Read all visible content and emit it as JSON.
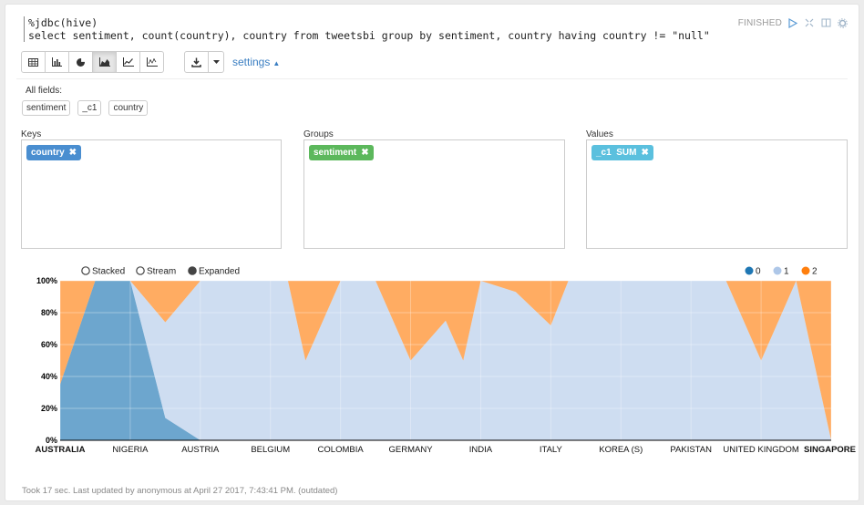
{
  "paragraph": {
    "code_lines": [
      "%jdbc(hive)",
      "select sentiment, count(country), country from tweetsbi group by sentiment, country having country != \"null\""
    ],
    "status": "FINISHED",
    "footer": "Took 17 sec. Last updated by anonymous at April 27 2017, 7:43:41 PM. (outdated)"
  },
  "toolbar": {
    "buttons": [
      "table-icon",
      "bar-chart-icon",
      "pie-chart-icon",
      "area-chart-icon",
      "line-chart-icon",
      "scatter-chart-icon"
    ],
    "active": "area-chart-icon",
    "settings_label": "settings"
  },
  "fields": {
    "label": "All fields:",
    "items": [
      "sentiment",
      "_c1",
      "country"
    ]
  },
  "keys": {
    "label": "Keys",
    "pill": "country",
    "color": "#4a8ed0"
  },
  "groups": {
    "label": "Groups",
    "pill": "sentiment",
    "color": "#5cb85c"
  },
  "values": {
    "label": "Values",
    "pill": "_c1  SUM",
    "color": "#5bc0de"
  },
  "chart_controls": {
    "modes": [
      "Stacked",
      "Stream",
      "Expanded"
    ],
    "selected": "Expanded"
  },
  "chart_data": {
    "type": "area",
    "stacking": "expanded",
    "categories": [
      "AUSTRALIA",
      "NIGERIA",
      "AUSTRIA",
      "BELGIUM",
      "COLOMBIA",
      "GERMANY",
      "INDIA",
      "ITALY",
      "KOREA (S)",
      "PAKISTAN",
      "UNITED KINGDOM",
      "SINGAPORE"
    ],
    "x_points": [
      0,
      1,
      1.5,
      2,
      3,
      4,
      5,
      6,
      6.5,
      7,
      8,
      8.5,
      9,
      10,
      11,
      11.5,
      12,
      13,
      14,
      14.5,
      15,
      16,
      17,
      18,
      19,
      20,
      21,
      22
    ],
    "series": [
      {
        "name": "0",
        "color": "#1f77b4",
        "values": [
          0.35,
          1.0,
          1.0,
          1.0,
          0.14,
          0.0,
          0,
          0,
          0,
          0,
          0,
          0,
          0,
          0,
          0,
          0,
          0,
          0,
          0,
          0,
          0,
          0,
          0,
          0,
          0,
          0,
          0,
          0
        ]
      },
      {
        "name": "1",
        "color": "#aec7e8",
        "values": [
          0.0,
          0.0,
          0.0,
          0.0,
          0.6,
          1.0,
          1.0,
          1.0,
          1.0,
          0.5,
          1.0,
          1.0,
          1.0,
          0.5,
          0.75,
          0.5,
          1.0,
          0.93,
          0.72,
          1.0,
          1.0,
          1.0,
          1.0,
          1.0,
          1.0,
          0.5,
          1.0,
          0.0
        ]
      },
      {
        "name": "2",
        "color": "#ff7f0e",
        "values": [
          0.65,
          0.0,
          0.0,
          0.0,
          0.26,
          0.0,
          0,
          0,
          0,
          0.5,
          0,
          0,
          0,
          0.5,
          0.25,
          0.5,
          0.0,
          0.07,
          0.28,
          0,
          0,
          0,
          0,
          0,
          0,
          0.5,
          0,
          1.0
        ]
      }
    ],
    "ylim": [
      0,
      1
    ],
    "y_ticks": [
      "0%",
      "20%",
      "40%",
      "60%",
      "80%",
      "100%"
    ],
    "legend_position": "top-right",
    "grid": true
  }
}
